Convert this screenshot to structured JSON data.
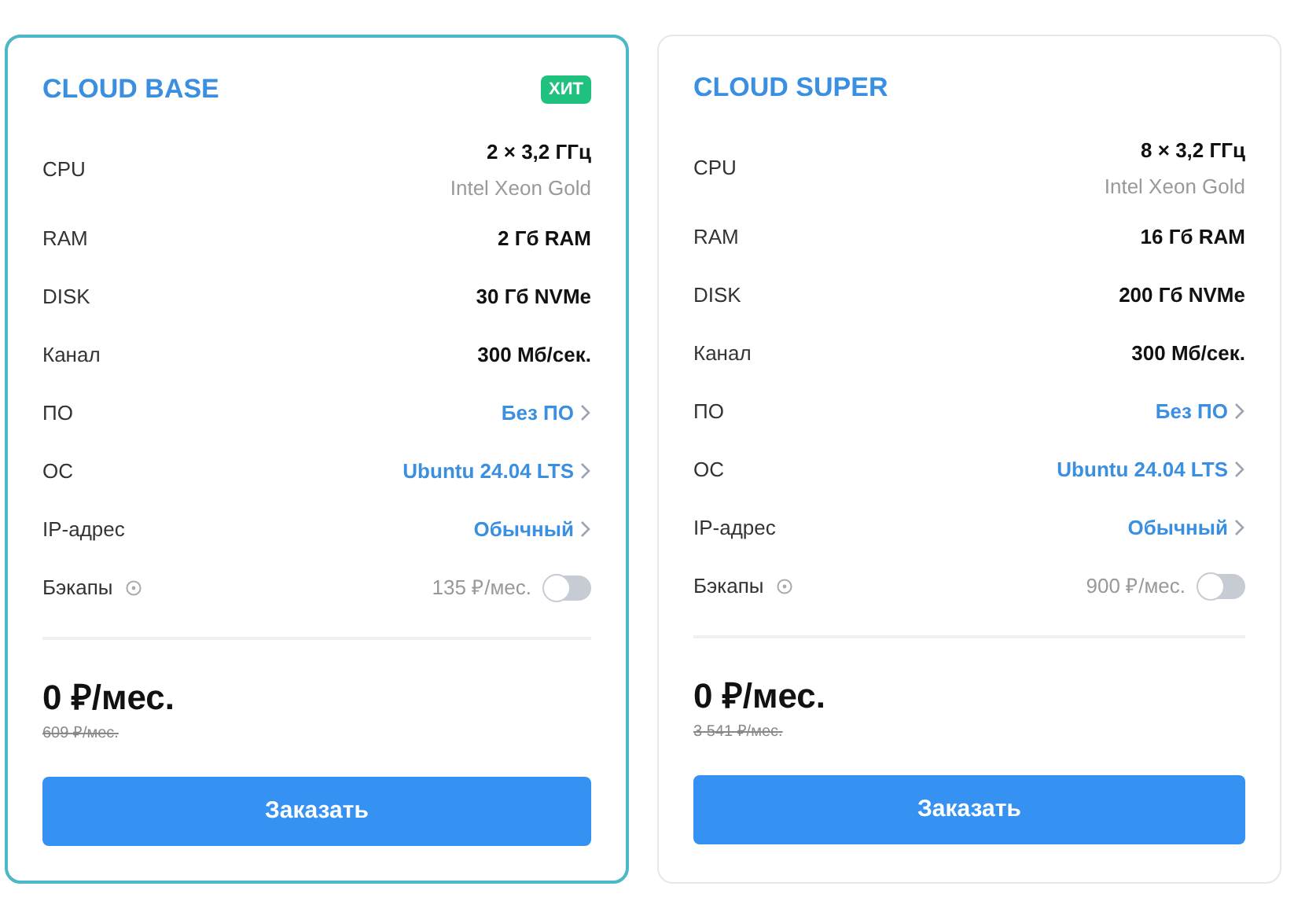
{
  "plans": [
    {
      "title": "CLOUD BASE",
      "highlighted": true,
      "badge": "ХИТ",
      "specs": [
        {
          "kind": "cpu",
          "label": "CPU",
          "value": "2 × 3,2 ГГц",
          "note": "Intel Xeon Gold"
        },
        {
          "kind": "plain",
          "label": "RAM",
          "value": "2 Гб RAM"
        },
        {
          "kind": "plain",
          "label": "DISK",
          "value": "30 Гб NVMe"
        },
        {
          "kind": "plain",
          "label": "Канал",
          "value": "300 Мб/сек."
        },
        {
          "kind": "link",
          "label": "ПО",
          "value": "Без ПО"
        },
        {
          "kind": "link",
          "label": "ОС",
          "value": "Ubuntu 24.04 LTS"
        },
        {
          "kind": "link",
          "label": "IP-адрес",
          "value": "Обычный"
        },
        {
          "kind": "toggle",
          "label": "Бэкапы",
          "value": "135 ₽/мес.",
          "on": false
        }
      ],
      "price": "0 ₽/мес.",
      "old_price": "609 ₽/мес.",
      "button": "Заказать"
    },
    {
      "title": "CLOUD SUPER",
      "highlighted": false,
      "specs": [
        {
          "kind": "cpu",
          "label": "CPU",
          "value": "8 × 3,2 ГГц",
          "note": "Intel Xeon Gold"
        },
        {
          "kind": "plain",
          "label": "RAM",
          "value": "16 Гб RAM"
        },
        {
          "kind": "plain",
          "label": "DISK",
          "value": "200 Гб NVMe"
        },
        {
          "kind": "plain",
          "label": "Канал",
          "value": "300 Мб/сек."
        },
        {
          "kind": "link",
          "label": "ПО",
          "value": "Без ПО"
        },
        {
          "kind": "link",
          "label": "ОС",
          "value": "Ubuntu 24.04 LTS"
        },
        {
          "kind": "link",
          "label": "IP-адрес",
          "value": "Обычный"
        },
        {
          "kind": "toggle",
          "label": "Бэкапы",
          "value": "900 ₽/мес.",
          "on": false
        }
      ],
      "price": "0 ₽/мес.",
      "old_price": "3 541 ₽/мес.",
      "button": "Заказать"
    }
  ]
}
